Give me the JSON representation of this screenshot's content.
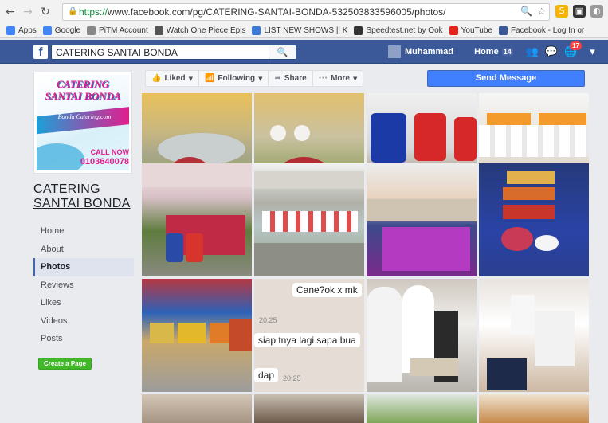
{
  "browser": {
    "url_scheme": "https://",
    "url_rest": "www.facebook.com/pg/CATERING-SANTAI-BONDA-532503833596005/photos/",
    "bookmarks": [
      {
        "label": "Apps",
        "icon": "apps-grid-icon",
        "color": "#4285f4"
      },
      {
        "label": "Google",
        "icon": "google-icon",
        "color": "#4285f4"
      },
      {
        "label": "PiTM Account",
        "icon": "pitm-icon",
        "color": "#888888"
      },
      {
        "label": "Watch One Piece Epis",
        "icon": "tv-icon",
        "color": "#555555"
      },
      {
        "label": "LIST NEW SHOWS || K",
        "icon": "list-icon",
        "color": "#3b7ad6"
      },
      {
        "label": "Speedtest.net by Ook",
        "icon": "speedtest-icon",
        "color": "#333333"
      },
      {
        "label": "YouTube",
        "icon": "youtube-icon",
        "color": "#e62117"
      },
      {
        "label": "Facebook - Log In or",
        "icon": "facebook-icon",
        "color": "#3b5998"
      }
    ]
  },
  "fb": {
    "search_value": "CATERING SANTAI BONDA",
    "user_name": "Muhammad",
    "home_label": "Home",
    "home_count": "14",
    "notif_count": "17"
  },
  "page": {
    "name_line1": "CATERING",
    "name_line2": "SANTAI BONDA",
    "logo_title": "CATERING SANTAI BONDA",
    "logo_sub": "Bonda Catering.com",
    "logo_call": "CALL NOW",
    "logo_phone": "0103640078",
    "nav": [
      "Home",
      "About",
      "Photos",
      "Reviews",
      "Likes",
      "Videos",
      "Posts"
    ],
    "active_nav": "Photos",
    "create_page": "Create a Page"
  },
  "actions": {
    "liked": "Liked",
    "following": "Following",
    "share": "Share",
    "more": "More",
    "send_message": "Send Message"
  },
  "chat": {
    "line1": "Cane?ok x mk",
    "time1": "20:25",
    "line2": "siap tnya lagi sapa bua",
    "line3": "dap",
    "time2": "20:25"
  },
  "colors": {
    "fb_blue": "#3b5998",
    "send_blue": "#4080ff",
    "create_green": "#42b72a",
    "brand_pink": "#e8198b"
  }
}
